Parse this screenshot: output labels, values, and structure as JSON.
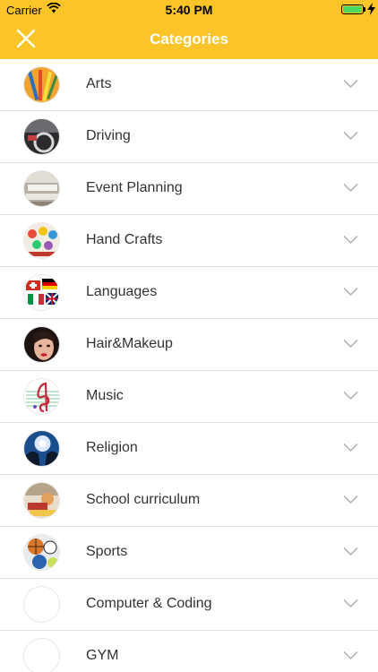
{
  "status_bar": {
    "carrier": "Carrier",
    "time": "5:40 PM",
    "battery_level_percent": 100,
    "battery_color": "#4cd964"
  },
  "header": {
    "title": "Categories",
    "background_color": "#fbc52a",
    "close_icon": "close-icon"
  },
  "categories": [
    {
      "label": "Arts",
      "icon": "arts-thumbnail"
    },
    {
      "label": "Driving",
      "icon": "driving-thumbnail"
    },
    {
      "label": "Event Planning",
      "icon": "event-planning-thumbnail"
    },
    {
      "label": "Hand Crafts",
      "icon": "hand-crafts-thumbnail"
    },
    {
      "label": "Languages",
      "icon": "languages-thumbnail"
    },
    {
      "label": "Hair&Makeup",
      "icon": "hair-makeup-thumbnail"
    },
    {
      "label": "Music",
      "icon": "music-thumbnail"
    },
    {
      "label": "Religion",
      "icon": "religion-thumbnail"
    },
    {
      "label": "School curriculum",
      "icon": "school-curriculum-thumbnail"
    },
    {
      "label": "Sports",
      "icon": "sports-thumbnail"
    },
    {
      "label": "Computer & Coding",
      "icon": "empty-thumbnail"
    },
    {
      "label": "GYM",
      "icon": "empty-thumbnail"
    }
  ]
}
